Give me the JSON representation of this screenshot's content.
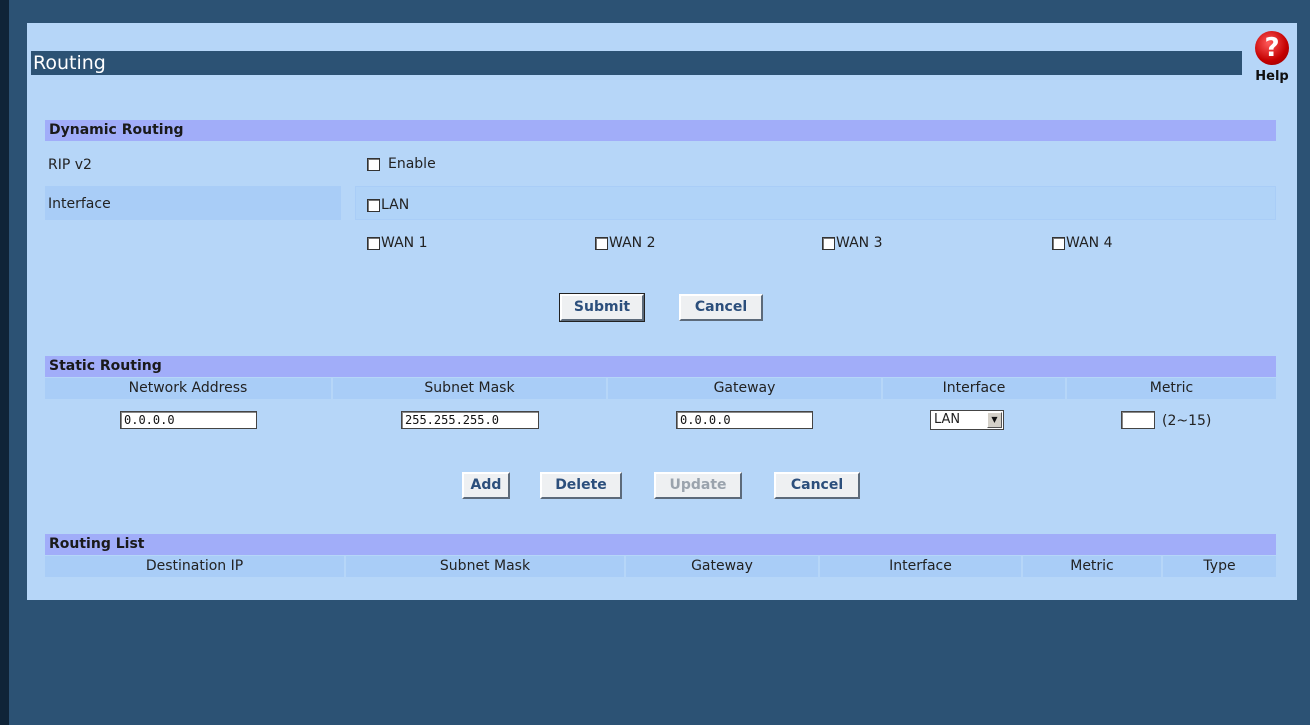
{
  "title": "Routing",
  "help_label": "Help",
  "dynamic": {
    "heading": "Dynamic Routing",
    "rip_label": "RIP v2",
    "enable_label": "Enable",
    "interface_label": "Interface",
    "lan_label": "LAN",
    "wan1": "WAN 1",
    "wan2": "WAN 2",
    "wan3": "WAN 3",
    "wan4": "WAN 4",
    "submit": "Submit",
    "cancel": "Cancel"
  },
  "static": {
    "heading": "Static Routing",
    "columns": [
      "Network Address",
      "Subnet Mask",
      "Gateway",
      "Interface",
      "Metric"
    ],
    "network_address": "0.0.0.0",
    "subnet_mask": "255.255.255.0",
    "gateway": "0.0.0.0",
    "interface_value": "LAN",
    "metric_value": "",
    "metric_range": "(2~15)",
    "add": "Add",
    "delete": "Delete",
    "update": "Update",
    "cancel": "Cancel"
  },
  "list": {
    "heading": "Routing List",
    "columns": [
      "Destination IP",
      "Subnet Mask",
      "Gateway",
      "Interface",
      "Metric",
      "Type"
    ]
  }
}
